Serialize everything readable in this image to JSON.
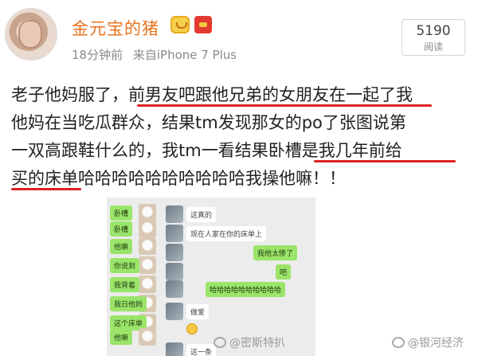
{
  "post": {
    "username": "金元宝的猪",
    "time": "18分钟前",
    "source": "来自iPhone 7 Plus",
    "read_count": "5190",
    "read_label": "阅读",
    "lines": [
      [
        "老子他妈服了，",
        "前男友吧跟他兄弟的女朋友在一起",
        "了我"
      ],
      [
        "他妈在当吃瓜群众，结果tm发现那女的po了张图说第"
      ],
      [
        "一双高跟鞋什么的，我tm一看结果卧槽是",
        "我几年前给"
      ],
      [
        "买的床单",
        "哈哈哈哈哈哈哈哈哈哈我操他嘛！！"
      ]
    ]
  },
  "chat": {
    "messages": [
      {
        "side": "right",
        "text": "卧槽"
      },
      {
        "side": "left",
        "text": "这真的"
      },
      {
        "side": "right",
        "text": "卧槽"
      },
      {
        "side": "left",
        "text": "现在人家在你的床单上"
      },
      {
        "side": "right",
        "text": "他嘛"
      },
      {
        "side": "left",
        "text": "我他太惨了"
      },
      {
        "side": "right",
        "text": "你说到"
      },
      {
        "side": "left",
        "text": "吧"
      },
      {
        "side": "right",
        "text": "我背着"
      },
      {
        "side": "left",
        "text": "哈哈哈哈哈哈哈哈哈哈"
      },
      {
        "side": "right",
        "text": "我日他妈"
      },
      {
        "side": "left",
        "text": "做爱"
      },
      {
        "side": "right",
        "text": "这个床单"
      },
      {
        "side": "right",
        "text": "他嘛"
      },
      {
        "side": "left",
        "text": "这一条"
      }
    ]
  },
  "watermarks": {
    "left": "@密斯特扒",
    "right": "@银河经济"
  },
  "colors": {
    "username": "#e8741f",
    "highlight_underline": "#dd2222",
    "chat_bubble_me": "#9be46a"
  }
}
